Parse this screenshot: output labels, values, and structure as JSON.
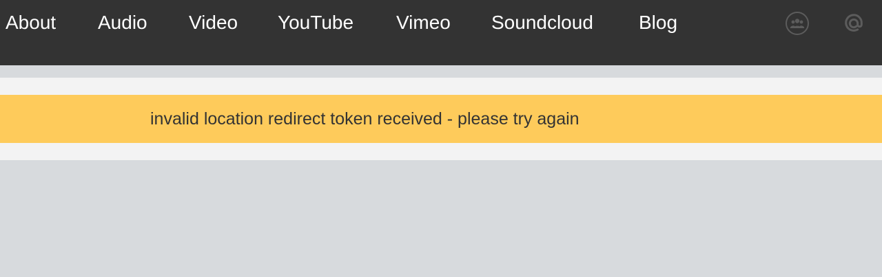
{
  "nav": {
    "items": [
      {
        "label": "About"
      },
      {
        "label": "Audio"
      },
      {
        "label": "Video"
      },
      {
        "label": "YouTube"
      },
      {
        "label": "Vimeo"
      },
      {
        "label": "Soundcloud"
      },
      {
        "label": "Blog"
      }
    ],
    "icons": [
      "community-icon",
      "at-sign-icon"
    ]
  },
  "alert": {
    "message": "invalid location redirect token received - please try again"
  },
  "colors": {
    "topbar": "#333333",
    "page_background": "#d7dadd",
    "alert_background": "#fecb5b",
    "band_background": "#f3f3f3",
    "icon_grey": "#5c5c5c"
  }
}
